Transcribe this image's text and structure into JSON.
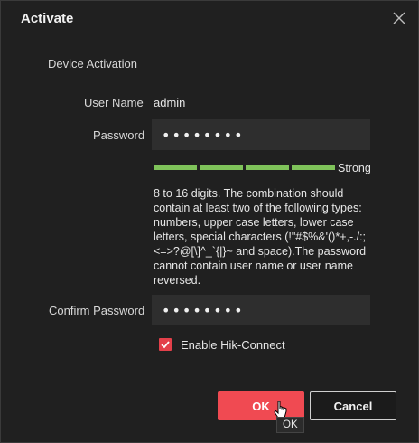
{
  "dialog": {
    "title": "Activate",
    "section_title": "Device Activation"
  },
  "form": {
    "username_label": "User Name",
    "username_value": "admin",
    "password_label": "Password",
    "password_value": "••••••••",
    "strength_label": "Strong",
    "strength_level": "4/4",
    "hint": "8 to 16 digits. The combination should contain at least two of the following types: numbers, upper case letters, lower case letters, special characters (!\"#$%&'()*+,-./:;<=>?@[\\]^_`{|}~ and space).The password cannot contain user name or user name reversed.",
    "confirm_label": "Confirm Password",
    "confirm_value": "••••••••",
    "hik_connect_label": "Enable Hik-Connect",
    "hik_connect_checked": true
  },
  "buttons": {
    "ok": "OK",
    "cancel": "Cancel"
  },
  "tooltip": "OK",
  "colors": {
    "accent": "#f04a52",
    "strength": "#7fc35a",
    "background": "#202020"
  }
}
